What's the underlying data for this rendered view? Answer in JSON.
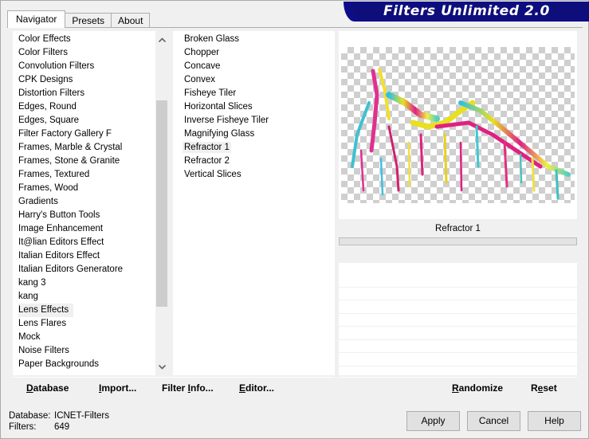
{
  "banner": {
    "title": "Filters Unlimited 2.0"
  },
  "tabs": [
    {
      "label": "Navigator",
      "active": true
    },
    {
      "label": "Presets",
      "active": false
    },
    {
      "label": "About",
      "active": false
    }
  ],
  "categories": {
    "items": [
      "Color Effects",
      "Color Filters",
      "Convolution Filters",
      "CPK Designs",
      "Distortion Filters",
      "Edges, Round",
      "Edges, Square",
      "Filter Factory Gallery F",
      "Frames, Marble & Crystal",
      "Frames, Stone & Granite",
      "Frames, Textured",
      "Frames, Wood",
      "Gradients",
      "Harry's Button Tools",
      "Image Enhancement",
      "It@lian Editors Effect",
      "Italian Editors Effect",
      "Italian Editors Generatore",
      "kang 3",
      "kang",
      "Lens Effects",
      "Lens Flares",
      "Mock",
      "Noise Filters",
      "Paper Backgrounds"
    ],
    "selected": "Lens Effects"
  },
  "filters": {
    "items": [
      "Broken Glass",
      "Chopper",
      "Concave",
      "Convex",
      "Fisheye Tiler",
      "Horizontal Slices",
      "Inverse Fisheye Tiler",
      "Magnifying Glass",
      "Refractor 1",
      "Refractor 2",
      "Vertical Slices"
    ],
    "selected": "Refractor 1"
  },
  "preview": {
    "filter_name": "Refractor 1"
  },
  "left_buttons": {
    "database": {
      "pre": "",
      "u": "D",
      "post": "atabase"
    },
    "import": {
      "pre": "",
      "u": "I",
      "post": "mport..."
    },
    "filter_info": {
      "pre": "Filter ",
      "u": "I",
      "post": "nfo..."
    },
    "editor": {
      "pre": "",
      "u": "E",
      "post": "ditor..."
    }
  },
  "right_buttons": {
    "randomize": {
      "pre": "",
      "u": "R",
      "post": "andomize"
    },
    "reset": {
      "pre": "R",
      "u": "e",
      "post": "set"
    }
  },
  "status": {
    "database_label": "Database:",
    "database_value": "ICNET-Filters",
    "filters_label": "Filters:",
    "filters_value": "649"
  },
  "dialog_buttons": {
    "apply": "Apply",
    "cancel": "Cancel",
    "help": "Help"
  },
  "colors": {
    "banner_bg": "#0d0d8a",
    "window_bg": "#f0f0f0",
    "list_bg": "#ffffff"
  }
}
